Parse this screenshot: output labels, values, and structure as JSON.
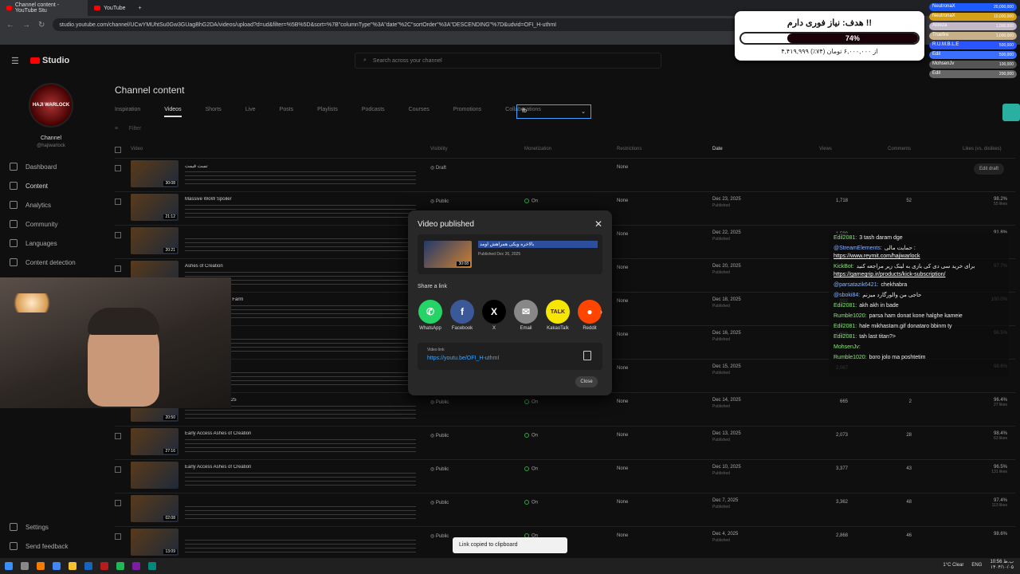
{
  "browser": {
    "tabs": [
      {
        "label": "Channel content - YouTube Stu"
      },
      {
        "label": "YouTube"
      }
    ],
    "url": "studio.youtube.com/channel/UCwYMUhtSu0Gw3GUagBhG2DA/videos/upload?d=ud&filter=%5B%5D&sort=%7B\"columnType\"%3A\"date\"%2C\"sortOrder\"%3A\"DESCENDING\"%7D&udvid=OFI_H-uthmI"
  },
  "studio": {
    "logo": "Studio",
    "search_placeholder": "Search across your channel",
    "channel_label": "Channel",
    "channel_handle": "@hajiwarlock",
    "avatar_text": "HAJI WARLOCK",
    "nav": [
      "Dashboard",
      "Content",
      "Analytics",
      "Community",
      "Languages",
      "Content detection"
    ],
    "bottom_nav": [
      "Settings",
      "Send feedback"
    ],
    "page_title": "Channel content",
    "tabs": [
      "Inspiration",
      "Videos",
      "Shorts",
      "Live",
      "Posts",
      "Playlists",
      "Podcasts",
      "Courses",
      "Promotions",
      "Collaborations"
    ],
    "filter_value": "fb",
    "filter_label": "Filter",
    "columns": [
      "Video",
      "Visibility",
      "Monetization",
      "Restrictions",
      "Date",
      "Views",
      "Comments",
      "Likes (vs. dislikes)"
    ]
  },
  "rows": [
    {
      "title": "تست قیمت",
      "duration": "30:08",
      "visibility": "Draft",
      "monetization": "",
      "restrictions": "None",
      "date": "",
      "date_sub": "",
      "views": "",
      "comments": "",
      "likes": "",
      "likes_sub": "",
      "draft": "Edit draft"
    },
    {
      "title": "Massive WoW Spoiler",
      "duration": "21:12",
      "visibility": "Public",
      "monetization": "On",
      "restrictions": "None",
      "date": "Dec 23, 2025",
      "date_sub": "Published",
      "views": "1,718",
      "comments": "52",
      "likes": "98.2%",
      "likes_sub": "55 likes",
      "draft": ""
    },
    {
      "title": "",
      "duration": "20:21",
      "visibility": "Public",
      "monetization": "On",
      "restrictions": "None",
      "date": "Dec 22, 2025",
      "date_sub": "Published",
      "views": "1,590",
      "comments": "",
      "likes": "91.8%",
      "likes_sub": "",
      "draft": ""
    },
    {
      "title": "Ashes of Creation",
      "duration": "",
      "visibility": "Public",
      "monetization": "On",
      "restrictions": "None",
      "date": "Dec 20, 2025",
      "date_sub": "Published",
      "views": "",
      "comments": "",
      "likes": "97.7%",
      "likes_sub": "",
      "draft": ""
    },
    {
      "title": "The Anniversary Gold Farm",
      "duration": "",
      "visibility": "Public",
      "monetization": "On",
      "restrictions": "None",
      "date": "Dec 18, 2025",
      "date_sub": "Published",
      "views": "992",
      "comments": "",
      "likes": "100.0%",
      "likes_sub": "",
      "draft": ""
    },
    {
      "title": "",
      "duration": "",
      "visibility": "Public",
      "monetization": "On",
      "restrictions": "None",
      "date": "Dec 16, 2025",
      "date_sub": "Published",
      "views": "2,516",
      "comments": "",
      "likes": "96.5%",
      "likes_sub": "",
      "draft": ""
    },
    {
      "title": "WoW 2",
      "duration": "",
      "visibility": "Public",
      "monetization": "On",
      "restrictions": "None",
      "date": "Dec 15, 2025",
      "date_sub": "Published",
      "views": "2,067",
      "comments": "",
      "likes": "98.6%",
      "likes_sub": "",
      "draft": ""
    },
    {
      "title": "The Game Awards 2025",
      "duration": "20:50",
      "visibility": "Public",
      "monetization": "On",
      "restrictions": "None",
      "date": "Dec 14, 2025",
      "date_sub": "Published",
      "views": "665",
      "comments": "2",
      "likes": "96.4%",
      "likes_sub": "27 likes",
      "draft": ""
    },
    {
      "title": "Early Access Ashes of Creation",
      "duration": "27:16",
      "visibility": "Public",
      "monetization": "On",
      "restrictions": "None",
      "date": "Dec 13, 2025",
      "date_sub": "Published",
      "views": "2,073",
      "comments": "28",
      "likes": "98.4%",
      "likes_sub": "63 likes",
      "draft": ""
    },
    {
      "title": "Early Access Ashes of Creation",
      "duration": "",
      "visibility": "Public",
      "monetization": "On",
      "restrictions": "None",
      "date": "Dec 10, 2025",
      "date_sub": "Published",
      "views": "3,377",
      "comments": "43",
      "likes": "96.5%",
      "likes_sub": "131 likes",
      "draft": ""
    },
    {
      "title": "",
      "duration": "02:08",
      "visibility": "Public",
      "monetization": "On",
      "restrictions": "None",
      "date": "Dec 7, 2025",
      "date_sub": "Published",
      "views": "3,362",
      "comments": "48",
      "likes": "97.4%",
      "likes_sub": "113 likes",
      "draft": ""
    },
    {
      "title": "",
      "duration": "13:09",
      "visibility": "Public",
      "monetization": "On",
      "restrictions": "None",
      "date": "Dec 4, 2025",
      "date_sub": "Published",
      "views": "2,868",
      "comments": "46",
      "likes": "98.6%",
      "likes_sub": "",
      "draft": ""
    }
  ],
  "modal": {
    "title": "Video published",
    "video_title": "بالاخره ویکی همراهش اومد",
    "video_date": "Published Dec 26, 2025",
    "duration": "30:08",
    "share_label": "Share a link",
    "share": [
      {
        "label": "WhatsApp",
        "glyph": "✆",
        "color": "#25d366"
      },
      {
        "label": "Facebook",
        "glyph": "f",
        "color": "#3b5998"
      },
      {
        "label": "X",
        "glyph": "X",
        "color": "#000000"
      },
      {
        "label": "Email",
        "glyph": "✉",
        "color": "#888888"
      },
      {
        "label": "KakaoTalk",
        "glyph": "TALK",
        "color": "#f7e600"
      },
      {
        "label": "Reddit",
        "glyph": "●",
        "color": "#ff4500"
      }
    ],
    "link_label": "Video link",
    "link": "https://youtu.be/OFI_H-uthmI",
    "close": "Close"
  },
  "toast": "Link copied to clipboard",
  "donation": {
    "heading": "هدف: نیاز فوری دارم !!",
    "percent": "74%",
    "percent_value": 0.74,
    "detail": "۴,۴۱۹,۹۹۹ از ۶,۰۰۰,۰۰۰ تومان (۷۴٪)"
  },
  "leaderboard": [
    {
      "name": "NeutronaX",
      "value": "20,000,000",
      "color": "#1e5bff"
    },
    {
      "name": "NeutronaX",
      "value": "10,000,000",
      "color": "#d4a017"
    },
    {
      "name": "Alireza",
      "value": "1,000,000",
      "color": "#c2b8c8"
    },
    {
      "name": "Truefire",
      "value": "1,000,000",
      "color": "#c8b088"
    },
    {
      "name": "R.U.M.B.L.E",
      "value": "500,000",
      "color": "#2a55ff"
    },
    {
      "name": "Edil",
      "value": "500,000",
      "color": "#3a6fff"
    },
    {
      "name": "MohsenJv",
      "value": "100,000",
      "color": "#555555"
    },
    {
      "name": "Edil",
      "value": "200,000",
      "color": "#666666"
    }
  ],
  "chat": [
    {
      "user": "Edil2081:",
      "text": "3 tash daram dge",
      "link": "",
      "g": true
    },
    {
      "user": "@StreamElements:",
      "text": "حمایت مالی :",
      "link": "https://www.reymit.com/hajiwarlock",
      "g": false
    },
    {
      "user": "KickBot:",
      "text": "برای خرید سی دی کی بازی به لینک زیر مراجعه کنید",
      "link": "https://gamegrip.ir/products/kick-subscription/",
      "g": true
    },
    {
      "user": "@parsatazik6421:",
      "text": "chekhabra",
      "link": "",
      "g": false
    },
    {
      "user": "@sboki84:",
      "text": "حاجی من والورگارد میزنم",
      "link": "",
      "g": false
    },
    {
      "user": "Edil2081:",
      "text": "akh akh in bade",
      "link": "",
      "g": true
    },
    {
      "user": "Rumble1020:",
      "text": "parsa ham donat kone halghe kameie",
      "link": "",
      "g": true
    },
    {
      "user": "Edil2081:",
      "text": "hale mikhastam.gif donataro bbinm ty",
      "link": "",
      "g": true
    },
    {
      "user": "Edil2081:",
      "text": "tah last titan?>",
      "link": "",
      "g": true
    },
    {
      "user": "MohsenJv:",
      "text": "",
      "link": "",
      "g": true
    },
    {
      "user": "Rumble1020:",
      "text": "boro jolo ma poshtetim",
      "link": "",
      "g": true
    }
  ],
  "tray": {
    "weather": "1°C  Clear",
    "lang": "ENG",
    "time": "10:56 ب.ظ",
    "date": "۱۴۰۴/۱۰/۰۵"
  }
}
